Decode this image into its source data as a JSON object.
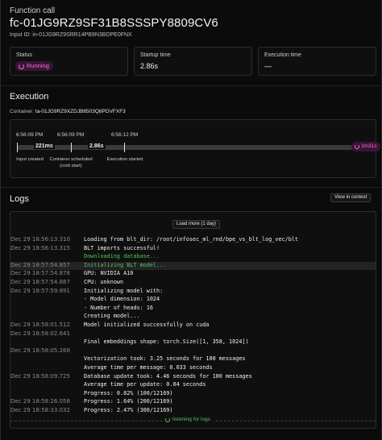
{
  "header": {
    "kicker": "Function call",
    "title": "fc-01JG9RZ9SF31B8SSSPY8809CV6",
    "input_id": "Input ID: in-01JG9RZ9SRR14PB9N3BDPE0FNX"
  },
  "stats": {
    "status_label": "Status",
    "status_value": "Running",
    "startup_label": "Startup time",
    "startup_value": "2.86s",
    "execution_label": "Execution time",
    "execution_value": "—"
  },
  "execution": {
    "title": "Execution",
    "container_label": "Container:",
    "container_id": "ta-01JG9RZ9XZDJB8503Q8PDVFXF3",
    "times": [
      "6:56:09 PM",
      "6:56:09 PM",
      "6:56:12 PM"
    ],
    "segments": [
      "221ms",
      "2.86s"
    ],
    "running_duration": "3m31s",
    "events": [
      "Input created",
      "Container scheduled\n(cold start)",
      "Execution started"
    ]
  },
  "logs": {
    "title": "Logs",
    "view_in_context": "View in context",
    "load_more": "Load more (1 day)",
    "listening": "listening for logs",
    "rows": [
      {
        "date": "Dec 29  18:56:13.310",
        "msg": "Loading from blt_dir: /root/infosec_ml_rnd/bpe_vs_blt_log_vec/blt",
        "style": ""
      },
      {
        "date": "Dec 29  18:56:13.315",
        "msg": "BLT imports successful!",
        "style": ""
      },
      {
        "date": "",
        "msg": "Downloading database...",
        "style": "green"
      },
      {
        "date": "Dec 29  18:57:54.857",
        "msg": "Initializing BLT model...",
        "style": "green"
      },
      {
        "date": "Dec 29  18:57:54.878",
        "msg": "GPU: NVIDIA A10",
        "style": ""
      },
      {
        "date": "Dec 29  18:57:54.887",
        "msg": "CPU: unknown",
        "style": ""
      },
      {
        "date": "Dec 29  18:57:59.891",
        "msg": "Initializing model with:",
        "style": ""
      },
      {
        "date": "",
        "msg": "- Model dimension: 1024",
        "style": ""
      },
      {
        "date": "",
        "msg": "- Number of heads: 16",
        "style": ""
      },
      {
        "date": "",
        "msg": "Creating model...",
        "style": ""
      },
      {
        "date": "Dec 29  18:58:01.512",
        "msg": "Model initialized successfully on cuda",
        "style": ""
      },
      {
        "date": "Dec 29  18:58:02.641",
        "msg": "",
        "style": ""
      },
      {
        "date": "",
        "msg": "Final embeddings shape: torch.Size([1, 358, 1024])",
        "style": ""
      },
      {
        "date": "Dec 29  18:58:05.268",
        "msg": "",
        "style": ""
      },
      {
        "date": "",
        "msg": "Vectorization took: 3.25 seconds for 100 messages",
        "style": ""
      },
      {
        "date": "",
        "msg": "Average time per message: 0.033 seconds",
        "style": ""
      },
      {
        "date": "Dec 29  18:58:09.725",
        "msg": "Database update took: 4.46 seconds for 100 messages",
        "style": ""
      },
      {
        "date": "",
        "msg": "Average time per update: 0.04 seconds",
        "style": ""
      },
      {
        "date": "",
        "msg": "Progress: 0.82% (100/12169)",
        "style": ""
      },
      {
        "date": "Dec 29  18:58:26.058",
        "msg": "Progress: 1.64% (200/12169)",
        "style": ""
      },
      {
        "date": "Dec 29  18:58:33.032",
        "msg": "Progress: 2.47% (300/12169)",
        "style": ""
      }
    ]
  }
}
